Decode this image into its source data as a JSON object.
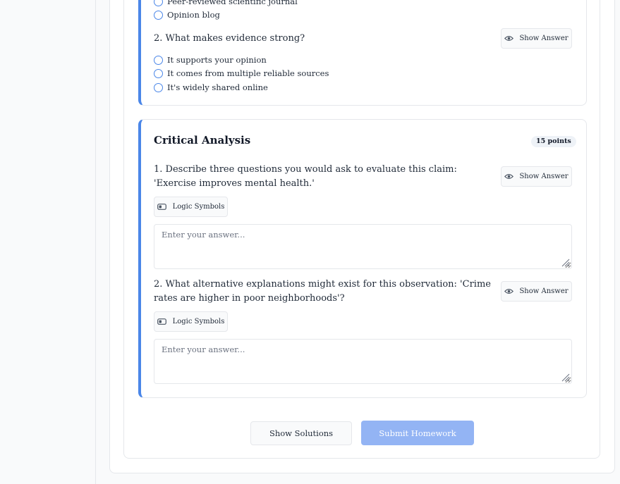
{
  "section_top": {
    "q1_options_visible": [
      "Peer-reviewed scientific journal",
      "Opinion blog"
    ],
    "q2": {
      "number": "2.",
      "text": "What makes evidence strong?",
      "show_answer_label": "Show Answer",
      "options": [
        "It supports your opinion",
        "It comes from multiple reliable sources",
        "It's widely shared online"
      ]
    }
  },
  "critical_analysis": {
    "title": "Critical Analysis",
    "points_badge": "15 points",
    "questions": [
      {
        "text": "1. Describe three questions you would ask to evaluate this claim: 'Exercise improves mental health.'",
        "show_answer_label": "Show Answer",
        "logic_symbols_label": "Logic Symbols",
        "answer_placeholder": "Enter your answer..."
      },
      {
        "text": "2. What alternative explanations might exist for this observation: 'Crime rates are higher in poor neighborhoods'?",
        "show_answer_label": "Show Answer",
        "logic_symbols_label": "Logic Symbols",
        "answer_placeholder": "Enter your answer..."
      }
    ]
  },
  "actions": {
    "show_solutions_label": "Show Solutions",
    "submit_label": "Submit Homework"
  },
  "colors": {
    "accent": "#4a86e8",
    "submit_disabled": "#93b4f4",
    "border": "#e5e7eb",
    "background": "#f9fafb"
  },
  "icons": {
    "show_answer": "eye-icon",
    "logic_symbols": "toggle-icon",
    "option_marker": "radio-circle"
  }
}
